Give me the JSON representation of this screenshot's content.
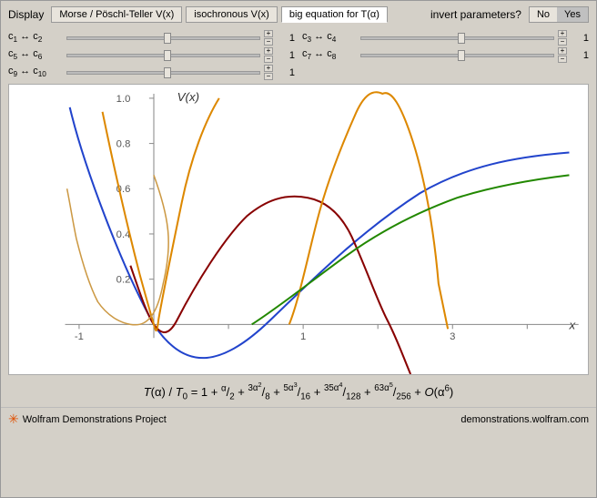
{
  "display_label": "Display",
  "tabs": [
    {
      "id": "morse",
      "label": "Morse / Pöschl-Teller V(x)",
      "active": false
    },
    {
      "id": "isochronous",
      "label": "isochronous V(x)",
      "active": false
    },
    {
      "id": "big_equation",
      "label": "big equation for T(α)",
      "active": true
    }
  ],
  "invert_label": "invert parameters?",
  "no_label": "No",
  "yes_label": "Yes",
  "yes_active": true,
  "sliders": [
    {
      "id": "c1c2",
      "label": "c₁ ↔ c₂",
      "value": 1,
      "col": 0
    },
    {
      "id": "c3c4",
      "label": "c₃ ↔ c₄",
      "value": 1,
      "col": 1
    },
    {
      "id": "c5c6",
      "label": "c₅ ↔ c₆",
      "value": 1,
      "col": 0
    },
    {
      "id": "c7c8",
      "label": "c₇ ↔ c₈",
      "value": 1,
      "col": 1
    },
    {
      "id": "c9c10",
      "label": "c₉ ↔ c₁₀",
      "value": 1,
      "col": 0
    }
  ],
  "graph_ylabel": "V(x)",
  "graph_xlabel": "x",
  "equation": "T(α) / T₀ = 1 + α/2 + 3α²/8 + 5α³/16 + 35α⁴/128 + 63α⁵/256 + O(α⁶)",
  "bottom_left": "Wolfram Demonstrations Project",
  "bottom_right": "demonstrations.wolfram.com",
  "wolfram_label": "WOLFRAM"
}
